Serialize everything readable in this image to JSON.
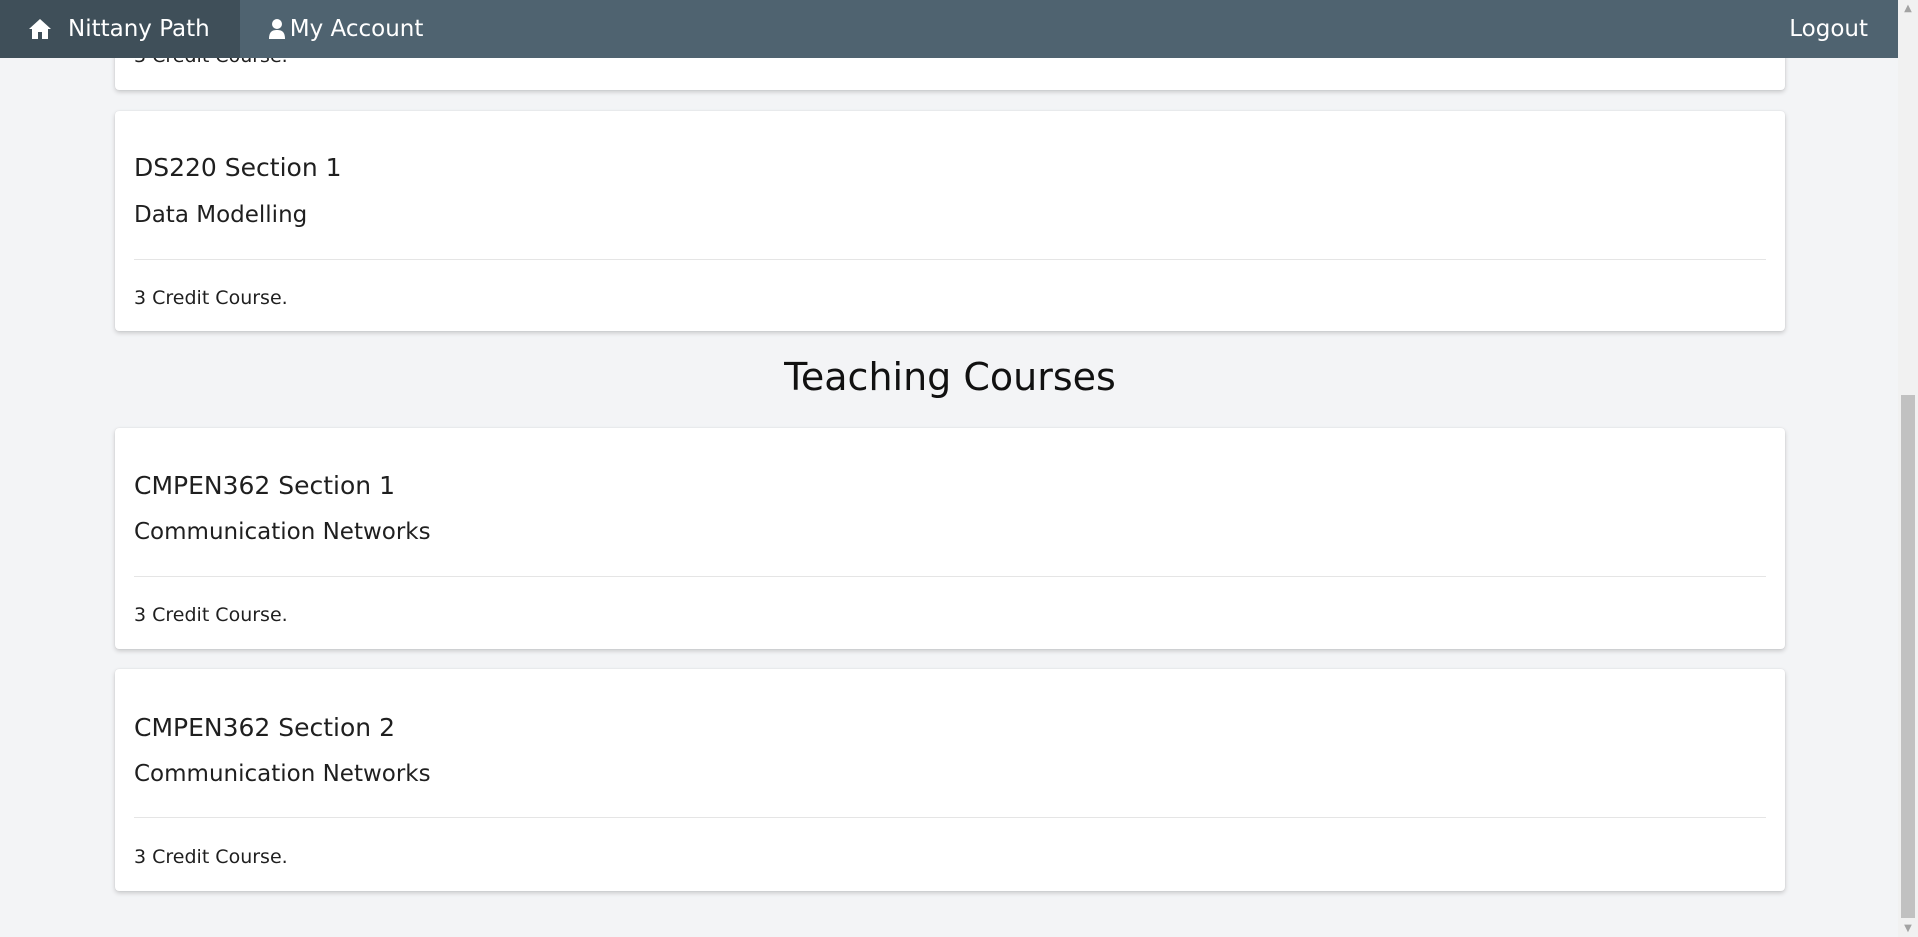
{
  "nav": {
    "home_label": "Nittany Path",
    "account_label": "My Account",
    "logout_label": "Logout"
  },
  "partial_card": {
    "credits": "3 Credit Course."
  },
  "courses": [
    {
      "code": "DS220 Section 1",
      "name": "Data Modelling",
      "credits": "3 Credit Course."
    }
  ],
  "teaching": {
    "title": "Teaching Courses",
    "courses": [
      {
        "code": "CMPEN362 Section 1",
        "name": "Communication Networks",
        "credits": "3 Credit Course."
      },
      {
        "code": "CMPEN362 Section 2",
        "name": "Communication Networks",
        "credits": "3 Credit Course."
      }
    ]
  },
  "colors": {
    "nav_bg": "#4f6370",
    "nav_active_bg": "#3f4f59",
    "page_bg": "#f3f4f6"
  }
}
